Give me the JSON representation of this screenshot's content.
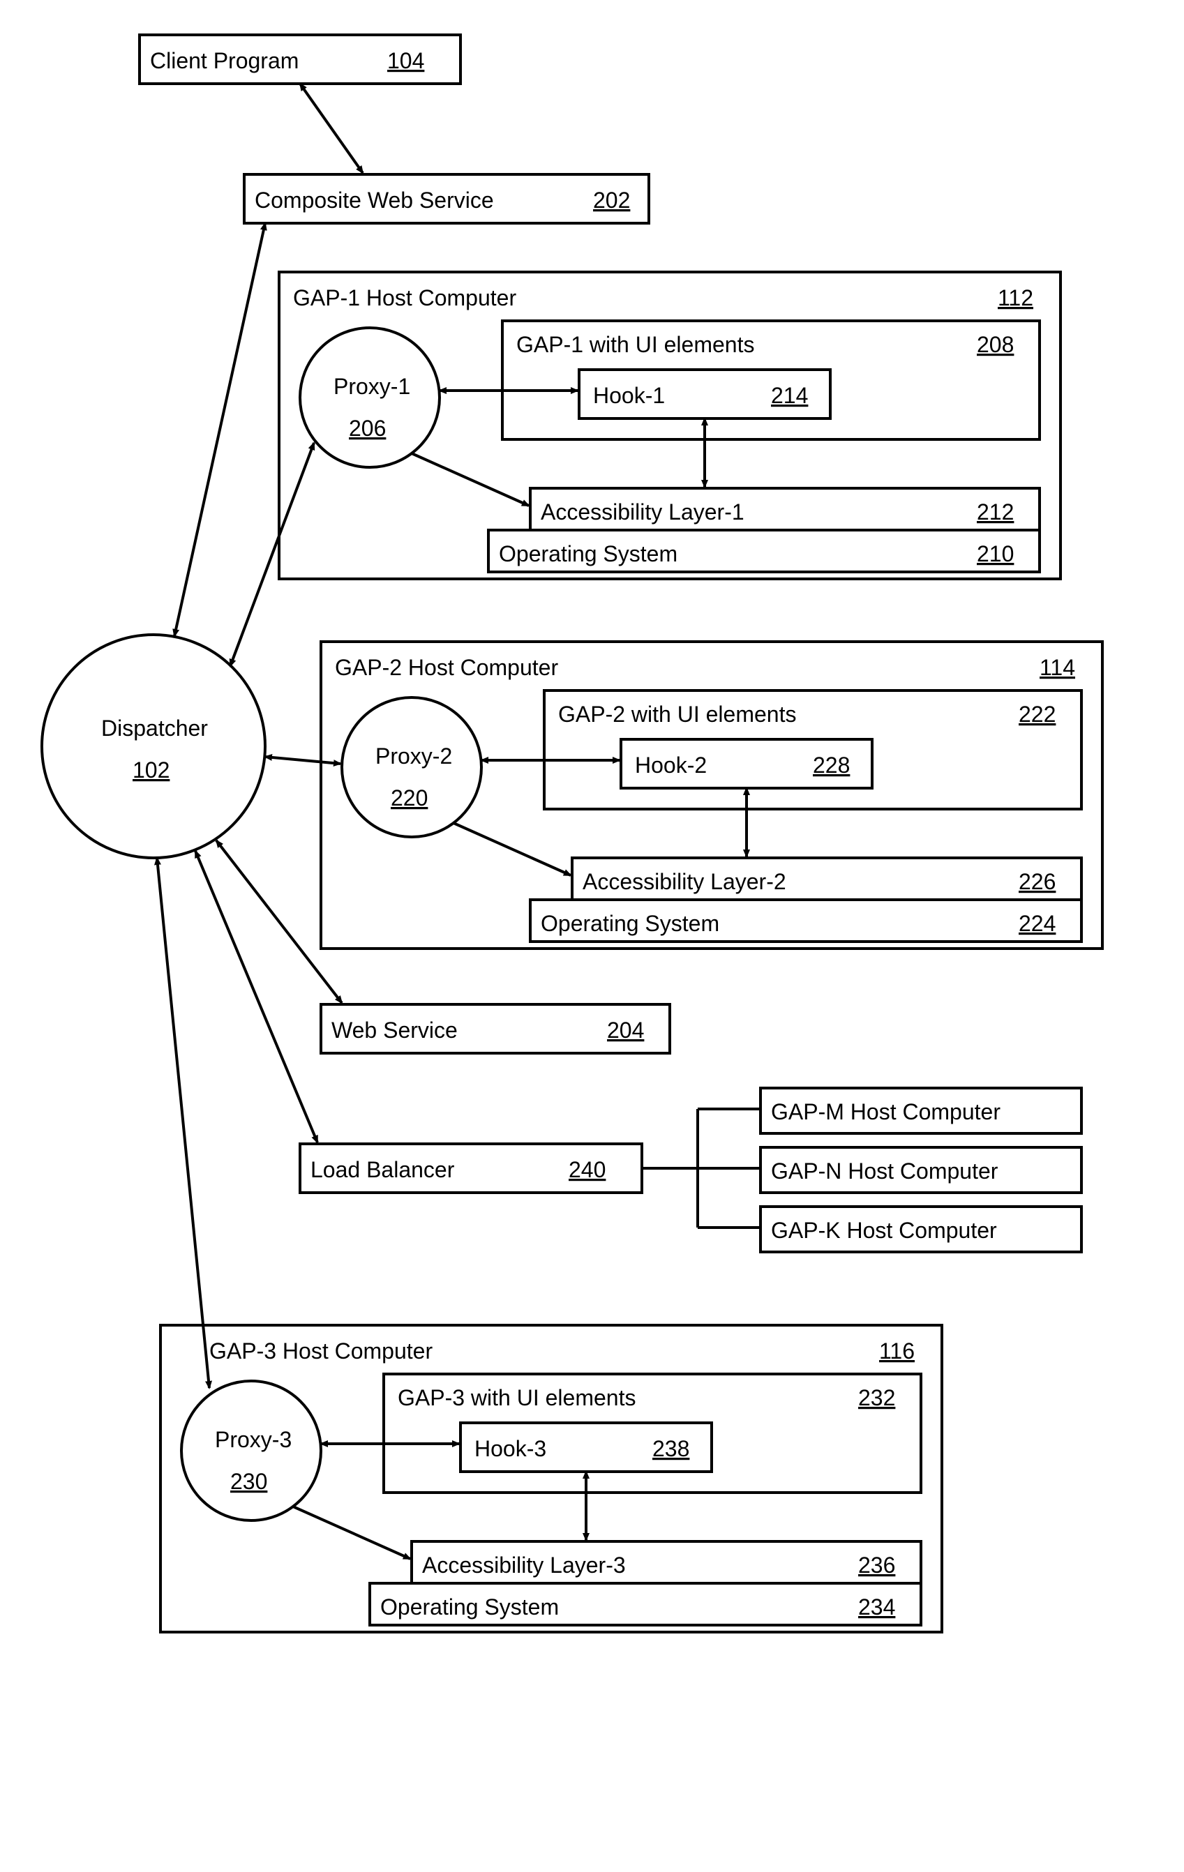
{
  "clientProgram": {
    "label": "Client Program",
    "num": "104"
  },
  "compositeWeb": {
    "label": "Composite Web Service",
    "num": "202"
  },
  "dispatcher": {
    "label": "Dispatcher",
    "num": "102"
  },
  "webService": {
    "label": "Web Service",
    "num": "204"
  },
  "loadBalancer": {
    "label": "Load Balancer",
    "num": "240"
  },
  "lbHosts": {
    "m": "GAP-M Host Computer",
    "n": "GAP-N Host Computer",
    "k": "GAP-K Host Computer"
  },
  "gap1": {
    "host": "GAP-1 Host Computer",
    "hostNum": "112",
    "proxy": "Proxy-1",
    "proxyNum": "206",
    "ui": "GAP-1 with UI elements",
    "uiNum": "208",
    "hook": "Hook-1",
    "hookNum": "214",
    "acc": "Accessibility Layer-1",
    "accNum": "212",
    "os": "Operating System",
    "osNum": "210"
  },
  "gap2": {
    "host": "GAP-2 Host Computer",
    "hostNum": "114",
    "proxy": "Proxy-2",
    "proxyNum": "220",
    "ui": "GAP-2 with UI elements",
    "uiNum": "222",
    "hook": "Hook-2",
    "hookNum": "228",
    "acc": "Accessibility Layer-2",
    "accNum": "226",
    "os": "Operating System",
    "osNum": "224"
  },
  "gap3": {
    "host": "GAP-3 Host Computer",
    "hostNum": "116",
    "proxy": "Proxy-3",
    "proxyNum": "230",
    "ui": "GAP-3 with UI elements",
    "uiNum": "232",
    "hook": "Hook-3",
    "hookNum": "238",
    "acc": "Accessibility Layer-3",
    "accNum": "236",
    "os": "Operating System",
    "osNum": "234"
  }
}
